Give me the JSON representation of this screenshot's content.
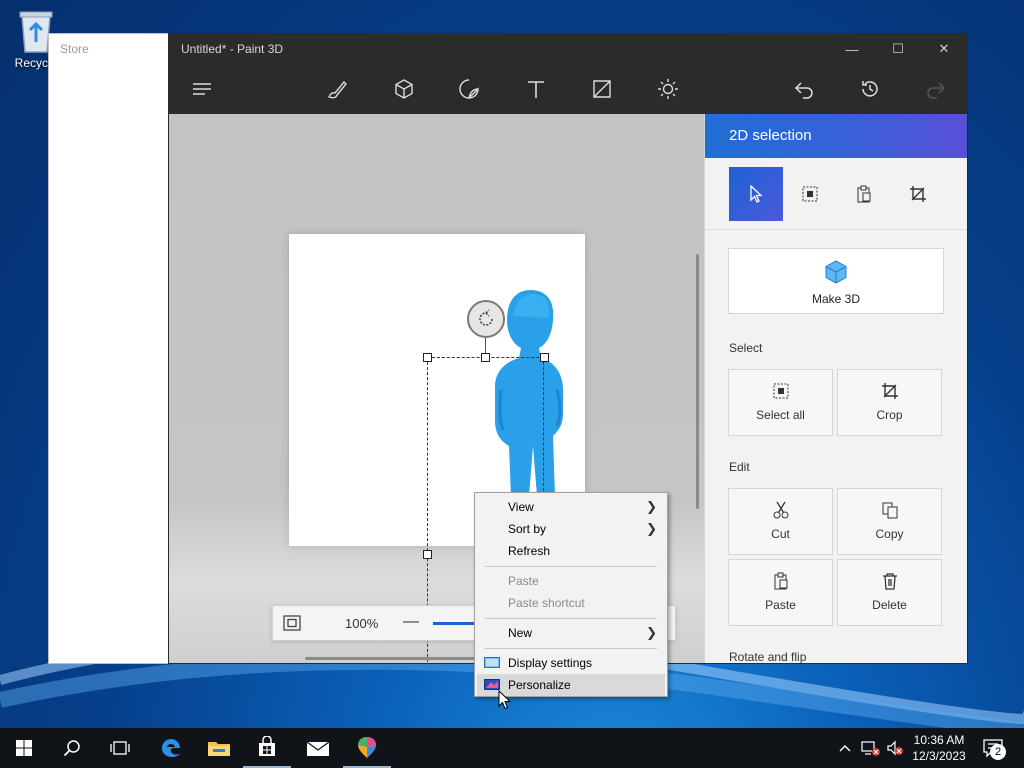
{
  "desktop": {
    "recycle_bin_label": "Recycle"
  },
  "store": {
    "title": "Store"
  },
  "paint": {
    "title": "Untitled* - Paint 3D",
    "window_buttons": {
      "minimize": "—",
      "maximize": "☐",
      "close": "✕"
    },
    "toolbar_icons": [
      "menu-icon",
      "brush-icon",
      "cube-icon",
      "sticker-icon",
      "text-icon",
      "canvas-icon",
      "effects-icon",
      "undo-icon",
      "history-icon",
      "redo-icon"
    ],
    "zoom": {
      "percent": "100%",
      "minus": "—"
    }
  },
  "panel": {
    "title": "2D selection",
    "make3d_label": "Make 3D",
    "select_section": "Select",
    "select_all_label": "Select all",
    "crop_label": "Crop",
    "edit_section": "Edit",
    "cut_label": "Cut",
    "copy_label": "Copy",
    "paste_label": "Paste",
    "delete_label": "Delete",
    "rotate_section": "Rotate and flip",
    "accent_color": "#2b6be0"
  },
  "context_menu": {
    "view": "View",
    "sort_by": "Sort by",
    "refresh": "Refresh",
    "paste": "Paste",
    "paste_shortcut": "Paste shortcut",
    "new": "New",
    "display_settings": "Display settings",
    "personalize": "Personalize"
  },
  "taskbar": {
    "time": "10:36 AM",
    "date": "12/3/2023",
    "notification_count": "2"
  }
}
